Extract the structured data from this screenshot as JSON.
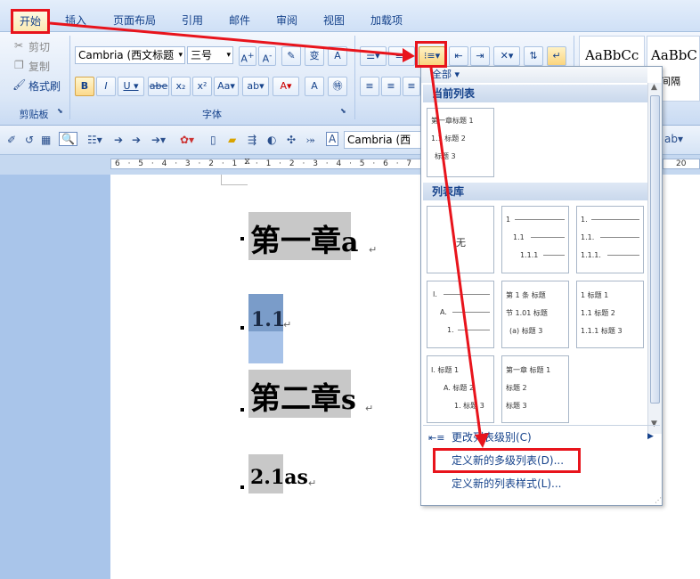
{
  "tabs": [
    "开始",
    "插入",
    "页面布局",
    "引用",
    "邮件",
    "审阅",
    "视图",
    "加载项"
  ],
  "clipboard": {
    "cut": "剪切",
    "copy": "复制",
    "format_painter": "格式刷",
    "group_label": "剪贴板"
  },
  "font": {
    "name": "Cambria (西文标题",
    "size": "三号",
    "group_label": "字体"
  },
  "styles": {
    "sample1": "AaBbCc",
    "sample2": "AaBbC",
    "label2": "无间隔"
  },
  "qbar": {
    "font_name": "Cambria (西"
  },
  "ruler": {
    "ticks": "6 · 5 · 4 · 3 · 2 · 1 · · 1 · 2 · 3 · 4 · 5 · 6 · 7",
    "right_tick": "20"
  },
  "document": {
    "headings": [
      "第一章a",
      "1.1",
      "第二章s",
      "2.1as"
    ],
    "heading_parts": [
      {
        "hl": "第一章",
        "tail": "a"
      },
      {
        "hl": "1.1",
        "tail": ""
      },
      {
        "hl": "第二章",
        "tail": "s"
      },
      {
        "hl": "2.1",
        "tail": "as"
      }
    ]
  },
  "dropdown": {
    "all_label": "全部 ▾",
    "current_list_header": "当前列表",
    "library_header": "列表库",
    "current_preview": [
      "第一章标题 1",
      "1.1 标题 2",
      "标题 3"
    ],
    "library": [
      {
        "lines": [
          "无"
        ]
      },
      {
        "lines": [
          "1",
          "1.1",
          "1.1.1"
        ]
      },
      {
        "lines": [
          "1.",
          "1.1.",
          "1.1.1."
        ]
      },
      {
        "lines": [
          "I.",
          "A.",
          "1."
        ]
      },
      {
        "lines": [
          "第 1 条 标题",
          "节 1.01 标题",
          "(a) 标题 3"
        ]
      },
      {
        "lines": [
          "1 标题 1",
          "1.1 标题 2",
          "1.1.1 标题 3"
        ]
      },
      {
        "lines": [
          "I. 标题 1",
          "A. 标题 2",
          "1. 标题 3"
        ]
      },
      {
        "lines": [
          "第一章 标题 1",
          "标题 2",
          "标题 3"
        ]
      }
    ],
    "change_level": "更改列表级别(C)",
    "define_new_multilevel": "定义新的多级列表(D)...",
    "define_new_style": "定义新的列表样式(L)..."
  },
  "colors": {
    "annotation_red": "#e8141c",
    "highlight_gray": "#c8c8c8",
    "selection_blue": "#a7c2e8"
  }
}
